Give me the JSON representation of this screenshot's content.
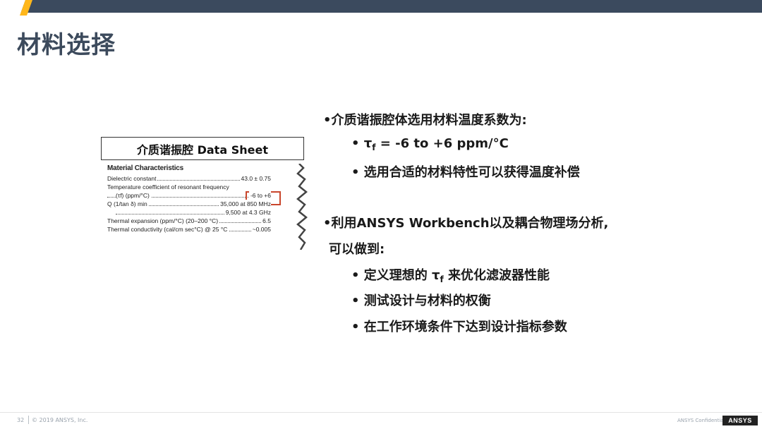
{
  "slide": {
    "title": "材料选择",
    "page_number": "32",
    "copyright": "© 2019 ANSYS, Inc.",
    "confidential": "ANSYS Confidential",
    "logo_text": "ANSYS"
  },
  "datasheet": {
    "title": "介质谐振腔 Data Sheet",
    "heading": "Material Characteristics",
    "rows": [
      {
        "label": "Dielectric constant",
        "value": "43.0 ± 0.75"
      },
      {
        "label": "Temperature coefficient of resonant frequency",
        "value": ""
      },
      {
        "label": "(τf) (ppm/°C)",
        "value": "-6 to +6"
      },
      {
        "label": "Q (1/tan δ) min",
        "value": "35,000 at 850 MHz"
      },
      {
        "label": "",
        "value": "9,500 at 4.3 GHz"
      },
      {
        "label": "Thermal expansion (ppm/°C) (20–200 °C)",
        "value": "6.5"
      },
      {
        "label": "Thermal conductivity (cal/cm sec°C) @ 25 °C",
        "value": "~0.005"
      }
    ]
  },
  "content": {
    "b1": "•介质谐振腔体选用材料温度系数为:",
    "b1_sub1_prefix": "• τ",
    "b1_sub1_subscript": "f",
    "b1_sub1_suffix": " = -6 to +6 ppm/°C",
    "b1_sub2": "• 选用合适的材料特性可以获得温度补偿",
    "b2_line1": "•利用ANSYS Workbench以及耦合物理场分析,",
    "b2_line2": "可以做到:",
    "b2_sub1_prefix": "• 定义理想的 τ",
    "b2_sub1_subscript": "f",
    "b2_sub1_suffix": " 来优化滤波器性能",
    "b2_sub2": "• 测试设计与材料的权衡",
    "b2_sub3": "• 在工作环境条件下达到设计指标参数"
  },
  "colors": {
    "header_bar": "#3b4a5e",
    "accent": "#ffb71b",
    "title": "#3c4a5c",
    "highlight": "#c9462c"
  }
}
